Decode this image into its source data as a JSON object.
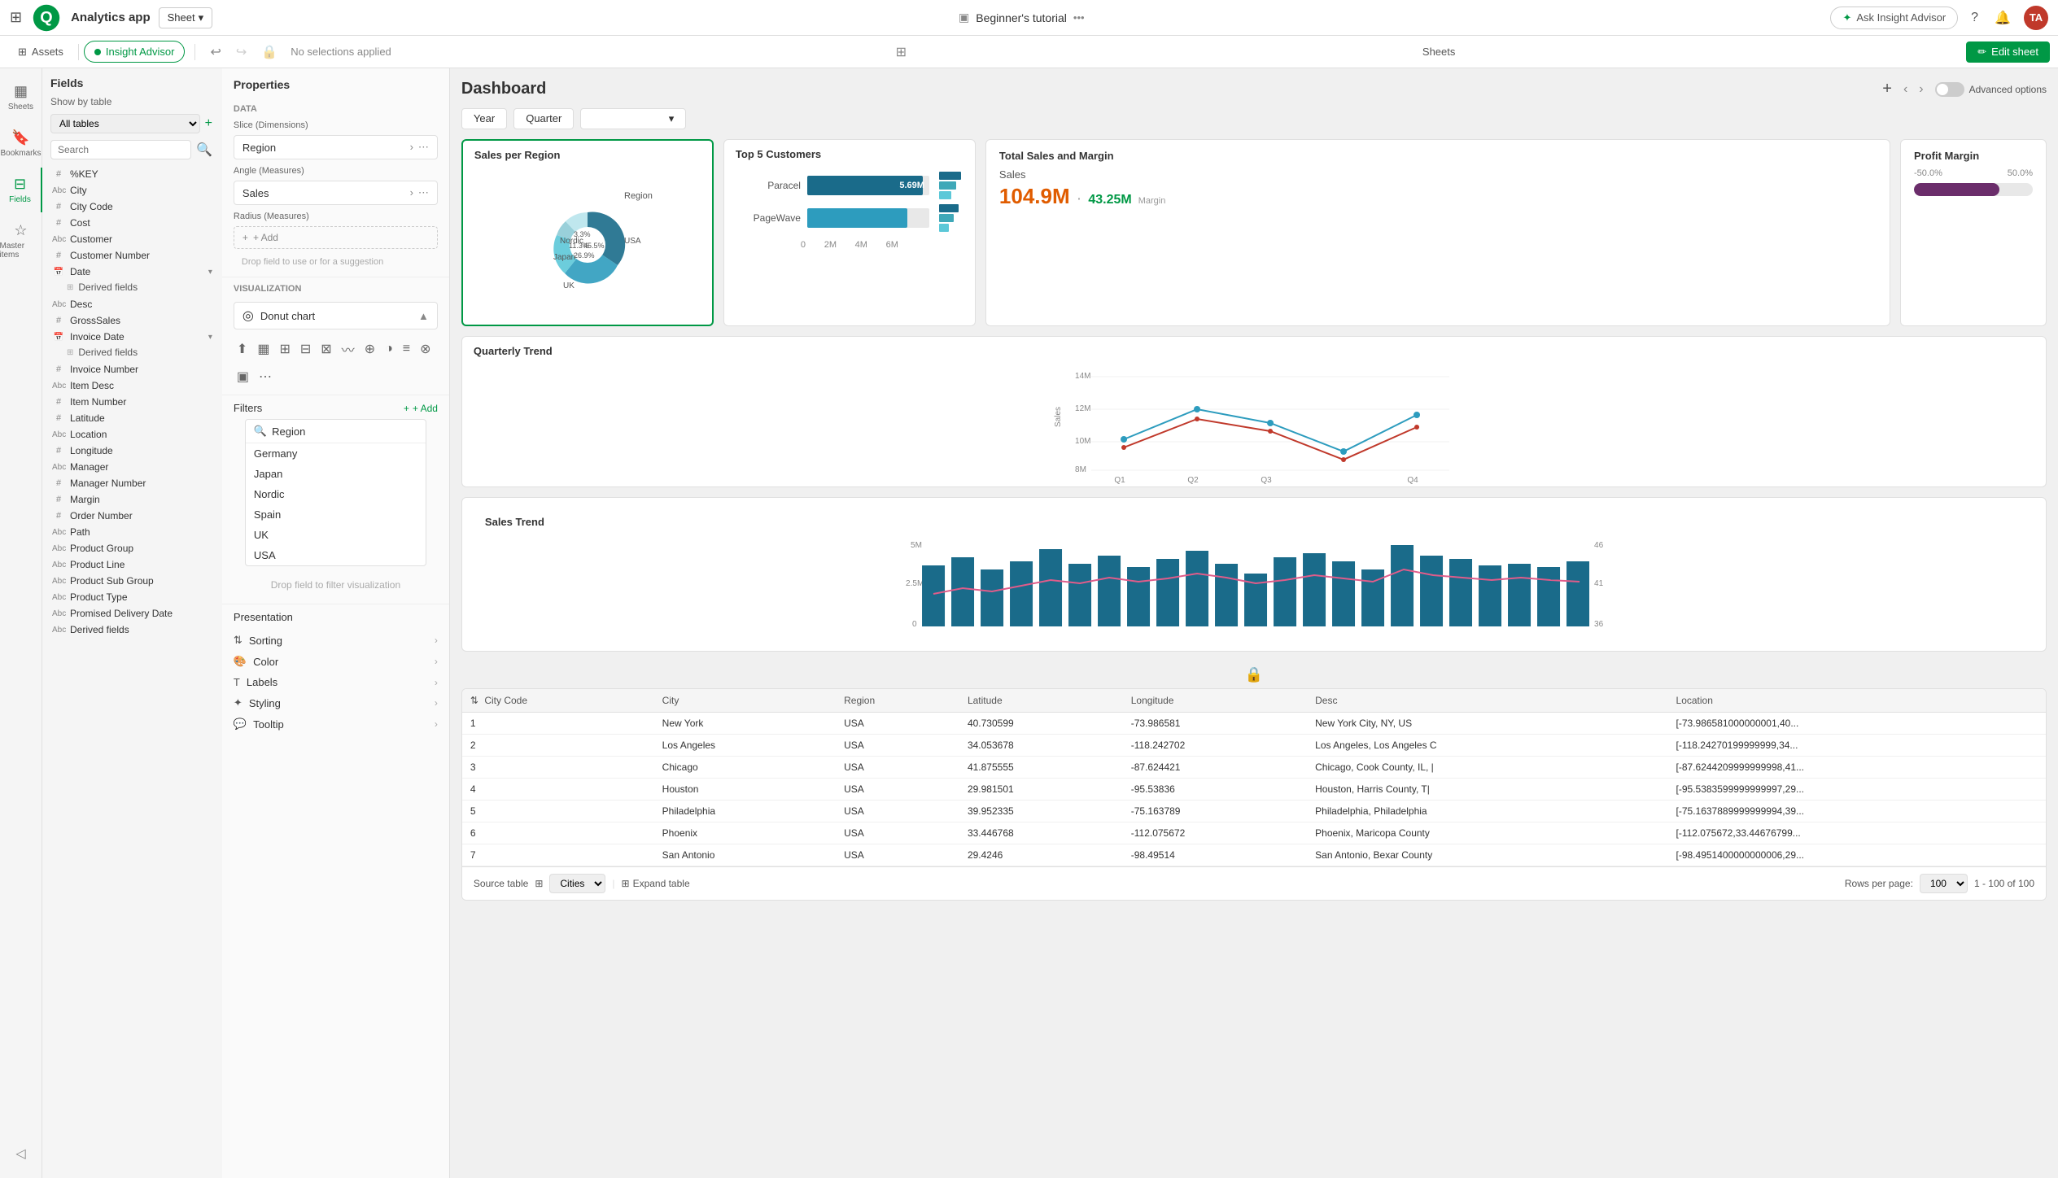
{
  "app": {
    "grid_icon": "⊞",
    "logo": "Q",
    "name": "Analytics app",
    "sheet_selector": "Sheet",
    "sheet_chevron": "▾",
    "tutorial_label": "Beginner's tutorial",
    "nav_dots": "•••",
    "ask_insight": "Ask Insight Advisor",
    "ask_icon": "✦",
    "help_icon": "?",
    "bell_icon": "🔔",
    "avatar_initials": "TA"
  },
  "second_nav": {
    "assets_label": "Assets",
    "insight_label": "Insight Advisor",
    "undo_icon": "↩",
    "redo_icon": "↪",
    "lock_icon": "🔒",
    "no_selections": "No selections applied",
    "grid_icon": "⊞",
    "sheets_label": "Sheets",
    "edit_sheet_label": "Edit sheet",
    "pencil_icon": "✏"
  },
  "sidebar": {
    "tabs": [
      {
        "id": "sheets",
        "label": "Sheets",
        "icon": "▦"
      },
      {
        "id": "bookmarks",
        "label": "Bookmarks",
        "icon": "🔖"
      },
      {
        "id": "fields",
        "label": "Fields",
        "icon": "⊟",
        "active": true
      },
      {
        "id": "master",
        "label": "Master items",
        "icon": "☆"
      }
    ],
    "fields_title": "Fields",
    "show_by": "Show by table",
    "table_value": "All tables",
    "search_placeholder": "Search",
    "fields": [
      {
        "type": "#",
        "name": "%KEY"
      },
      {
        "type": "Abc",
        "name": "City"
      },
      {
        "type": "#",
        "name": "City Code"
      },
      {
        "type": "#",
        "name": "Cost"
      },
      {
        "type": "Abc",
        "name": "Customer"
      },
      {
        "type": "#",
        "name": "Customer Number"
      },
      {
        "type": "📅",
        "name": "Date",
        "has_derived": true,
        "derived": [
          "Derived fields"
        ]
      },
      {
        "type": "Abc",
        "name": "Desc"
      },
      {
        "type": "#",
        "name": "GrossSales"
      },
      {
        "type": "📅",
        "name": "Invoice Date",
        "has_derived": true,
        "derived": [
          "Derived fields"
        ]
      },
      {
        "type": "#",
        "name": "Invoice Number"
      },
      {
        "type": "Abc",
        "name": "Item Desc"
      },
      {
        "type": "#",
        "name": "Item Number"
      },
      {
        "type": "#",
        "name": "Latitude"
      },
      {
        "type": "Abc",
        "name": "Location"
      },
      {
        "type": "#",
        "name": "Longitude"
      },
      {
        "type": "Abc",
        "name": "Manager"
      },
      {
        "type": "#",
        "name": "Manager Number"
      },
      {
        "type": "#",
        "name": "Margin"
      },
      {
        "type": "#",
        "name": "Order Number"
      },
      {
        "type": "Abc",
        "name": "Path"
      },
      {
        "type": "Abc",
        "name": "Product Group"
      },
      {
        "type": "Abc",
        "name": "Product Line"
      },
      {
        "type": "Abc",
        "name": "Product Sub Group"
      },
      {
        "type": "Abc",
        "name": "Product Type"
      },
      {
        "type": "Abc",
        "name": "Promised Delivery Date"
      },
      {
        "type": "Abc",
        "name": "Derived fields"
      }
    ]
  },
  "properties": {
    "title": "Properties",
    "data_section": "Data",
    "slice_label": "Slice (Dimensions)",
    "slice_value": "Region",
    "angle_label": "Angle (Measures)",
    "angle_value": "Sales",
    "radius_label": "Radius (Measures)",
    "add_label": "+ Add",
    "drop_hint": "Drop field to use or for a suggestion",
    "visualization_label": "Visualization",
    "donut_chart": "Donut chart",
    "expand_icon": "▲",
    "collapse_icon": "▼",
    "filters_label": "Filters",
    "add_filter": "+ Add",
    "filter_drop_hint": "Drop field to filter visualization",
    "presentation_label": "Presentation",
    "sorting_label": "Sorting",
    "color_label": "Color",
    "labels_label": "Labels",
    "styling_label": "Styling",
    "tooltip_label": "Tooltip",
    "region_filter": {
      "search_icon": "🔍",
      "items": [
        "Germany",
        "Japan",
        "Nordic",
        "Spain",
        "UK",
        "USA"
      ]
    }
  },
  "dashboard": {
    "title": "Dashboard",
    "add_icon": "+",
    "prev_icon": "‹",
    "next_icon": "›",
    "advanced_options": "Advanced options",
    "charts": {
      "sales_per_region": {
        "title": "Sales per Region",
        "donut": {
          "usa_pct": "45.5%",
          "uk_pct": "26.9%",
          "japan_pct": "11.3%",
          "nordic_pct": "3.3%",
          "labels": [
            "Region",
            "Nordic",
            "Japan",
            "USA",
            "UK"
          ],
          "values": [
            45.5,
            26.9,
            11.3,
            3.3,
            13.0
          ],
          "colors": [
            "#2d7f8a",
            "#3fa8b8",
            "#5cc8d8",
            "#1a5a6b",
            "#8ecbd6"
          ]
        }
      },
      "total_sales": {
        "title": "Total Sales and Margin",
        "sales_label": "Sales",
        "sales_value": "104.9M",
        "sep": "·",
        "margin_value": "43.25M",
        "margin_label": "Margin"
      },
      "profit_margin": {
        "title": "Profit Margin",
        "min_val": "-50.0%",
        "max_val": "50.0%",
        "fill_pct": 72
      },
      "quarterly_trend": {
        "title": "Quarterly Trend",
        "y_labels": [
          "14M",
          "12M",
          "10M",
          "8M"
        ],
        "x_labels": [
          "Q1",
          "Q2",
          "Q3",
          "Q4"
        ],
        "sales_label": "Sales"
      },
      "top5_customers": {
        "title": "Top 5 Customers",
        "bars": [
          {
            "label": "Paracel",
            "value": "5.69M",
            "pct": 95
          },
          {
            "label": "PageWave",
            "value": "",
            "pct": 85
          }
        ],
        "x_labels": [
          "0",
          "2M",
          "4M",
          "6M"
        ]
      },
      "sales_trend": {
        "title": "Sales Trend",
        "y_labels_left": [
          "5M",
          "2.5M",
          "0"
        ],
        "y_labels_right": [
          "46",
          "41",
          "36"
        ]
      }
    },
    "table": {
      "columns": [
        "City Code",
        "City",
        "Region",
        "Latitude",
        "Longitude",
        "Desc",
        "Location"
      ],
      "rows": [
        {
          "code": "1",
          "city": "New York",
          "region": "USA",
          "lat": "40.730599",
          "lon": "-73.986581",
          "desc": "New York City, NY, US",
          "location": "[-73.986581000000001,40..."
        },
        {
          "code": "2",
          "city": "Los Angeles",
          "region": "USA",
          "lat": "34.053678",
          "lon": "-118.242702",
          "desc": "Los Angeles, Los Angeles C",
          "location": "[-118.24270199999999,34..."
        },
        {
          "code": "3",
          "city": "Chicago",
          "region": "USA",
          "lat": "41.875555",
          "lon": "-87.624421",
          "desc": "Chicago, Cook County, IL, |",
          "location": "[-87.6244209999999998,41..."
        },
        {
          "code": "4",
          "city": "Houston",
          "region": "USA",
          "lat": "29.981501",
          "lon": "-95.53836",
          "desc": "Houston, Harris County, T|",
          "location": "[-95.5383599999999997,29..."
        },
        {
          "code": "5",
          "city": "Philadelphia",
          "region": "USA",
          "lat": "39.952335",
          "lon": "-75.163789",
          "desc": "Philadelphia, Philadelphia",
          "location": "[-75.1637889999999994,39..."
        },
        {
          "code": "6",
          "city": "Phoenix",
          "region": "USA",
          "lat": "33.446768",
          "lon": "-112.075672",
          "desc": "Phoenix, Maricopa County",
          "location": "[-112.075672,33.44676799..."
        },
        {
          "code": "7",
          "city": "San Antonio",
          "region": "USA",
          "lat": "29.4246",
          "lon": "-98.49514",
          "desc": "San Antonio, Bexar County",
          "location": "[-98.4951400000000006,29..."
        }
      ],
      "source_label": "Source table",
      "source_table": "Cities",
      "expand_btn": "Expand table",
      "rows_per_page": "Rows per page:",
      "rows_value": "100",
      "pagination": "1 - 100 of 100"
    }
  }
}
